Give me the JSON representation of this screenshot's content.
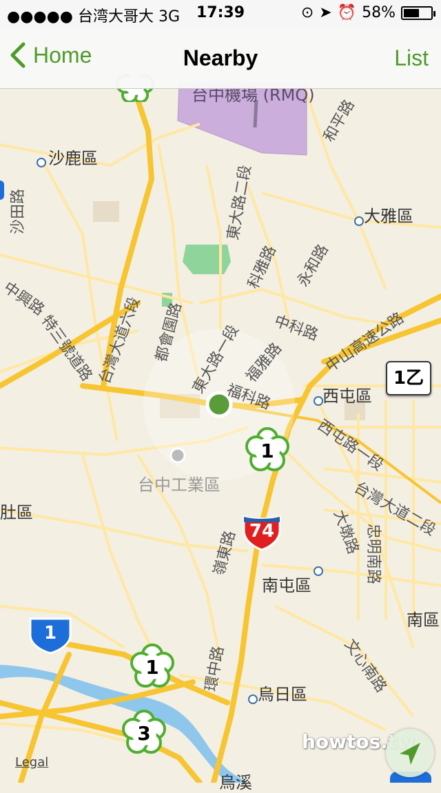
{
  "status_bar": {
    "carrier": "●●●●● 台湾大哥大 3G",
    "time": "17:39",
    "battery": "58%",
    "battery_level": 0.58
  },
  "nav": {
    "back_label": "Home",
    "title": "Nearby",
    "right_label": "List"
  },
  "map": {
    "airport_label": "台中機場 (RMQ)",
    "districts": [
      "沙鹿區",
      "大雅區",
      "西屯區",
      "南屯區",
      "烏日區",
      "台中工業區",
      "肚區",
      "南區",
      "烏溪"
    ],
    "roads": [
      "沙田路",
      "中興路",
      "特三號道路",
      "台灣大道六段",
      "東大路二段",
      "東大路一段",
      "都會園路",
      "科雅路",
      "永和路",
      "中科路",
      "中山高速公路",
      "福雅路",
      "福科路",
      "西屯路一段",
      "台灣大道二段",
      "大墩路",
      "忠明南路",
      "嶺東路",
      "文心南路",
      "環中路",
      "和平路"
    ],
    "markers": [
      "1",
      "1",
      "3"
    ],
    "freeway_shield": "74",
    "national_shield": "1",
    "route_box": "1乙"
  },
  "legal": "Legal",
  "watermark": "howtos.tw",
  "colors": {
    "accent": "#4f9a2a",
    "major_road": "#f7c531",
    "minor_road": "#ffe8a3",
    "water": "#8fc6ec",
    "airport": "#cbaedb",
    "park": "#8fd49a",
    "land": "#f3efe3"
  }
}
